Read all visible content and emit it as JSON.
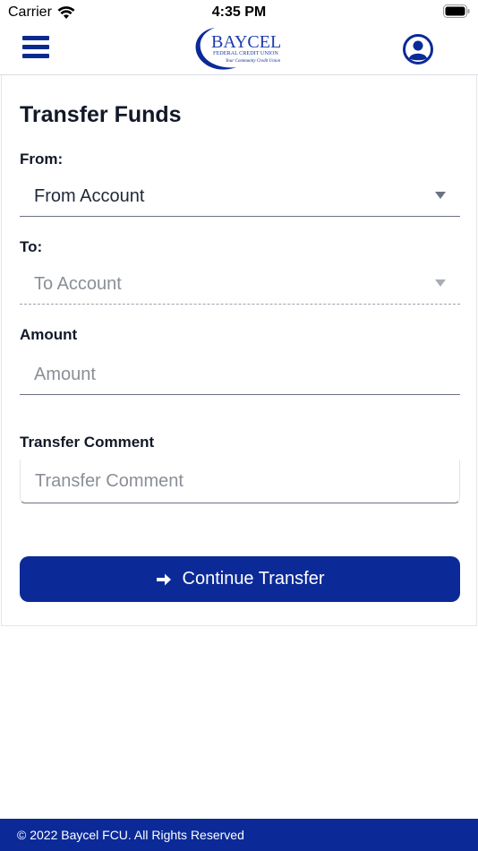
{
  "status_bar": {
    "carrier": "Carrier",
    "time": "4:35 PM",
    "wifi_icon": "wifi-icon",
    "battery_icon": "battery-icon"
  },
  "header": {
    "menu_icon": "hamburger-menu-icon",
    "logo": {
      "name": "BAYCEL",
      "line2": "FEDERAL CREDIT UNION",
      "tagline": "Your Community Credit Union"
    },
    "profile_icon": "user-circle-icon"
  },
  "form": {
    "title": "Transfer Funds",
    "from_label": "From:",
    "from_value": "From Account",
    "to_label": "To:",
    "to_placeholder": "To Account",
    "amount_label": "Amount",
    "amount_placeholder": "Amount",
    "comment_label": "Transfer Comment",
    "comment_placeholder": "Transfer Comment",
    "continue_button": "Continue Transfer",
    "continue_icon": "arrow-right-icon"
  },
  "footer": {
    "copyright": "© 2022 Baycel FCU. All Rights Reserved"
  },
  "colors": {
    "brand_blue": "#0b2a98",
    "border": "#6b7280",
    "placeholder": "#8a8f96"
  }
}
